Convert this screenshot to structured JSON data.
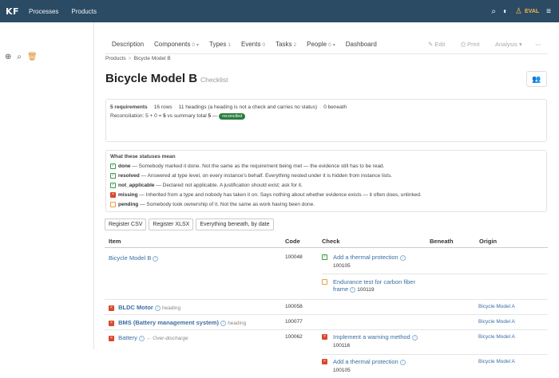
{
  "app": {
    "logo": "KF",
    "nav": [
      "Processes",
      "Products"
    ],
    "user": "EVAL"
  },
  "tabs": [
    {
      "label": "Description",
      "count": "",
      "caret": false
    },
    {
      "label": "Components",
      "count": "0",
      "caret": true
    },
    {
      "label": "Types",
      "count": "1",
      "caret": false
    },
    {
      "label": "Events",
      "count": "0",
      "caret": false
    },
    {
      "label": "Tasks",
      "count": "2",
      "caret": false
    },
    {
      "label": "People",
      "count": "0",
      "caret": true
    },
    {
      "label": "Dashboard",
      "count": "",
      "caret": false
    }
  ],
  "tab_actions": {
    "edit": "Edit",
    "print": "Print",
    "analysis": "Analysis",
    "more": "···"
  },
  "breadcrumb": [
    "Products",
    "Bicycle Model B"
  ],
  "title": "Bicycle Model B",
  "subtitle": "Checklist",
  "summary": {
    "requirements": "5 requirements",
    "rows": "16 rows",
    "headings": "11 headings (a heading is not a check and carries no status)",
    "beneath": "0 beneath",
    "reconciliation_prefix": "Reconciliation: 5 + 0 = ",
    "reconciliation_total": "5",
    "reconciliation_mid": " vs summary total ",
    "reconciliation_summary": "5",
    "reconciliation_suffix": " —",
    "badge": "reconciled"
  },
  "statuses": {
    "heading": "What these statuses mean",
    "items": [
      {
        "name": "done",
        "desc": " — Somebody marked it done. Not the same as the requirement being met — the evidence still has to be read."
      },
      {
        "name": "resolved",
        "desc": " — Answered at type level, on every instance's behalf. Everything nested under it is hidden from instance lists."
      },
      {
        "name": "not_applicable",
        "desc": " — Declared not applicable. A justification should exist; ask for it."
      },
      {
        "name": "missing",
        "desc": " — Inherited from a type and nobody has taken it on. Says nothing about whether evidence exists — it often does, unlinked."
      },
      {
        "name": "pending",
        "desc": " — Somebody took ownership of it. Not the same as work having been done."
      }
    ]
  },
  "buttons": [
    "Register CSV",
    "Register XLSX",
    "Everything beneath, by date"
  ],
  "table": {
    "headers": [
      "Item",
      "Code",
      "Check",
      "Beneath",
      "Origin"
    ],
    "rows": [
      {
        "item": "Bicycle Model B",
        "code": "100048",
        "checks": [
          {
            "label": "Add a thermal protection",
            "code": "100105",
            "status": "done"
          },
          {
            "label": "Endurance test for carbon fiber frame",
            "code": "100119",
            "status": "pending"
          }
        ]
      },
      {
        "item": "BLDC Motor",
        "tag": "heading",
        "code": "100058",
        "origin": "Bicycle Model A"
      },
      {
        "item": "BMS (Battery management system)",
        "tag": "heading",
        "code": "100077",
        "origin": "Bicycle Model A"
      },
      {
        "item": "Battery",
        "arrow": "← Over-discharge",
        "code": "100062",
        "checks": [
          {
            "label": "Implement a warning method",
            "code": "100116",
            "status": "missing",
            "origin": "Bicycle Model A"
          },
          {
            "label": "Add a thermal protection",
            "code": "100105",
            "status": "missing",
            "origin": "Bicycle Model A"
          }
        ]
      }
    ]
  }
}
